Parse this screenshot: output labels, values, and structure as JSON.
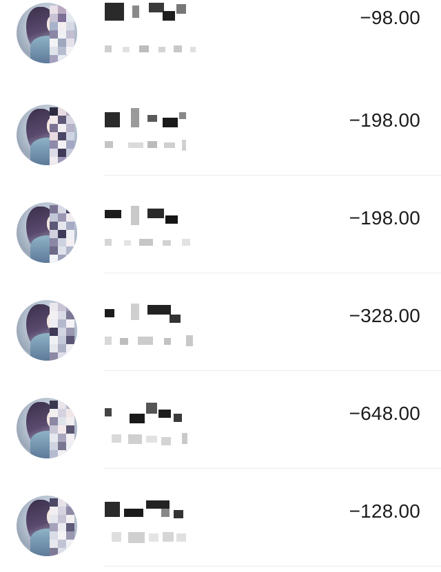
{
  "transactions": [
    {
      "amount": "−98.00"
    },
    {
      "amount": "−198.00"
    },
    {
      "amount": "−198.00"
    },
    {
      "amount": "−328.00"
    },
    {
      "amount": "−648.00"
    },
    {
      "amount": "−128.00"
    }
  ]
}
